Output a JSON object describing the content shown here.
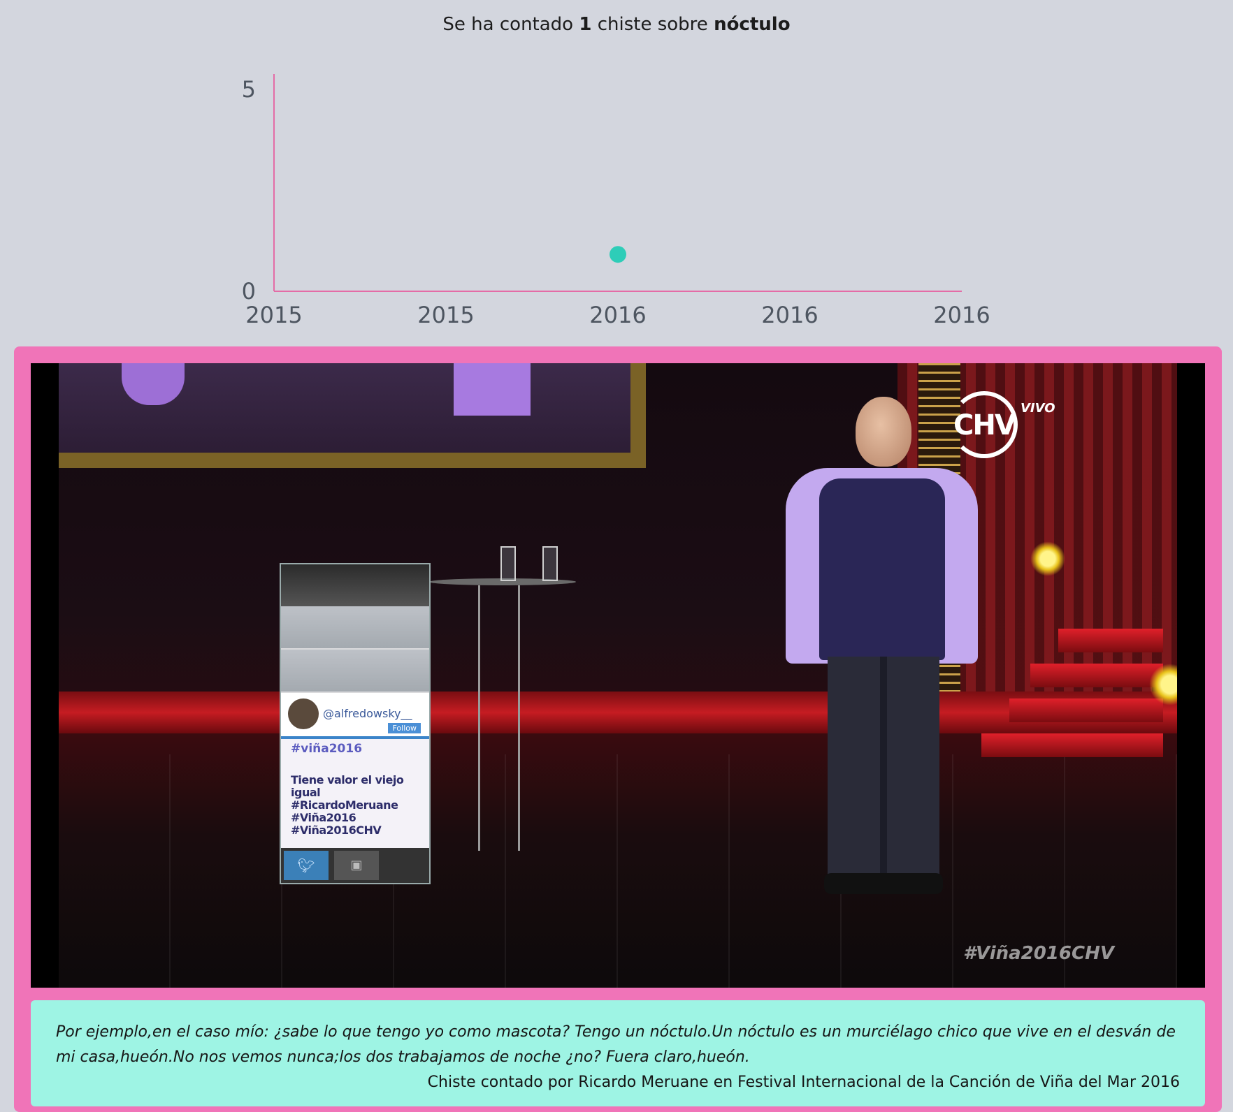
{
  "headline": {
    "prefix": "Se ha contado",
    "count": "1",
    "middle": "chiste sobre",
    "term": "nóctulo"
  },
  "chart_data": {
    "type": "scatter",
    "xlabel": "",
    "ylabel": "",
    "x_ticks": [
      "2015",
      "2015",
      "2016",
      "2016",
      "2016"
    ],
    "y_ticks": [
      "0",
      "5"
    ],
    "ylim": [
      0,
      5
    ],
    "points": [
      {
        "x": "2016",
        "y": 1
      }
    ],
    "colors": {
      "axis": "#e46ca6",
      "point": "#2ecdb8",
      "tick_text": "#4d5560"
    },
    "grid": false
  },
  "video": {
    "overlay_logo": "CHV",
    "overlay_live": "VIVO",
    "overlay_hashtag": "#Viña2016CHV",
    "tweet": {
      "user": "@alfredowsky__",
      "follow_label": "Follow",
      "hashtag": "#viña2016",
      "body_lines": [
        "Tiene valor el viejo igual",
        "#RicardoMeruane",
        "#Viña2016 #Viña2016CHV"
      ],
      "twitter_icon": "twitter-bird-icon",
      "instagram_icon": "instagram-icon"
    }
  },
  "joke": {
    "text": "Por ejemplo,en el caso mío: ¿sabe lo que tengo yo como mascota? Tengo un nóctulo.Un nóctulo es un murciélago chico que vive en el desván de mi casa,hueón.No nos vemos nunca;los dos trabajamos de noche ¿no? Fuera claro,hueón.",
    "source": "Chiste contado por Ricardo Meruane en Festival Internacional de la Canción de Viña del Mar 2016"
  },
  "colors": {
    "page_bg": "#d3d6de",
    "card_border": "#f074b8",
    "quote_bg": "#9ef4e4"
  }
}
